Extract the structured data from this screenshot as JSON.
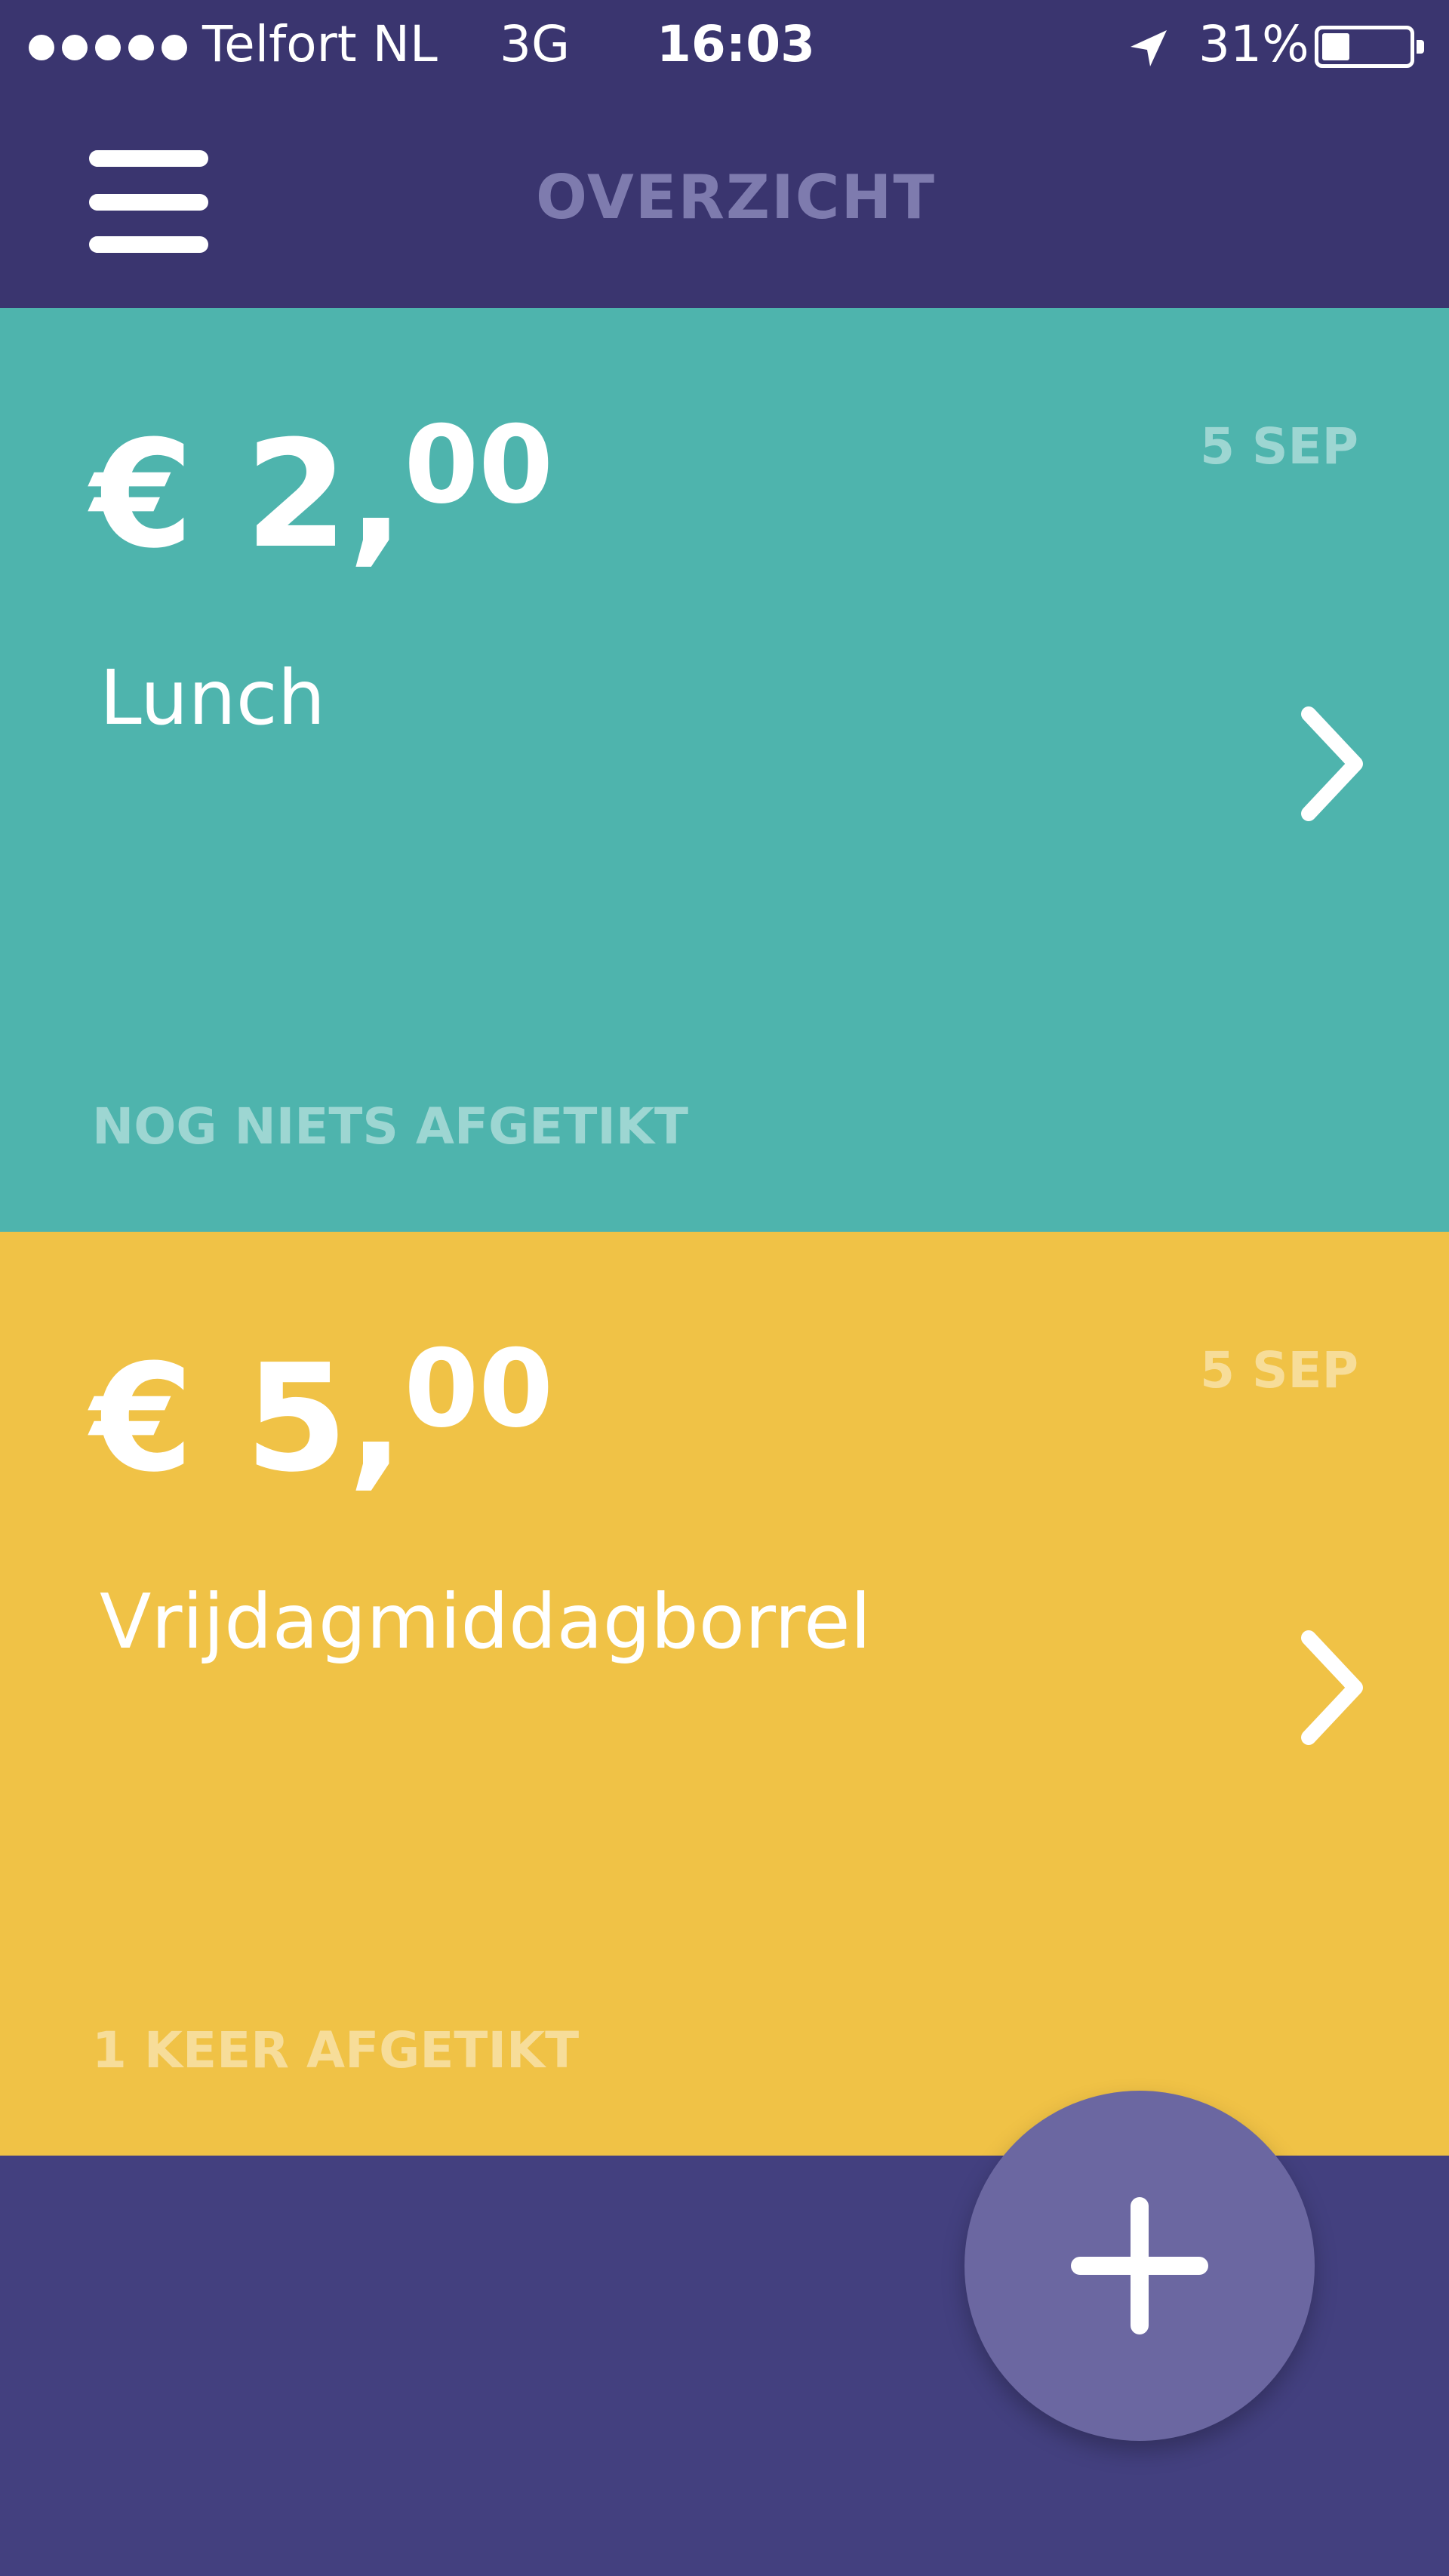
{
  "status_bar": {
    "carrier": "Telfort NL",
    "network": "3G",
    "time": "16:03",
    "battery_percent": "31%",
    "battery_level": 0.31,
    "icons": [
      "signal-dots-icon",
      "location-arrow-icon",
      "battery-icon"
    ]
  },
  "header": {
    "title": "OVERZICHT",
    "menu_icon": "hamburger-menu-icon"
  },
  "cards": [
    {
      "amount_main": "€ 2,",
      "amount_cents": "00",
      "description": "Lunch",
      "date": "5 SEP",
      "status": "NOG NIETS AFGETIKT",
      "color": "#4eb4ad",
      "icon": "chevron-right-icon"
    },
    {
      "amount_main": "€ 5,",
      "amount_cents": "00",
      "description": "Vrijdagmiddagborrel",
      "date": "5 SEP",
      "status": "1 KEER AFGETIKT",
      "color": "#f0c246",
      "icon": "chevron-right-icon"
    }
  ],
  "fab": {
    "icon": "plus-icon",
    "color": "#6b67a1"
  },
  "colors": {
    "header": "#3a356f",
    "background": "#43407f"
  }
}
